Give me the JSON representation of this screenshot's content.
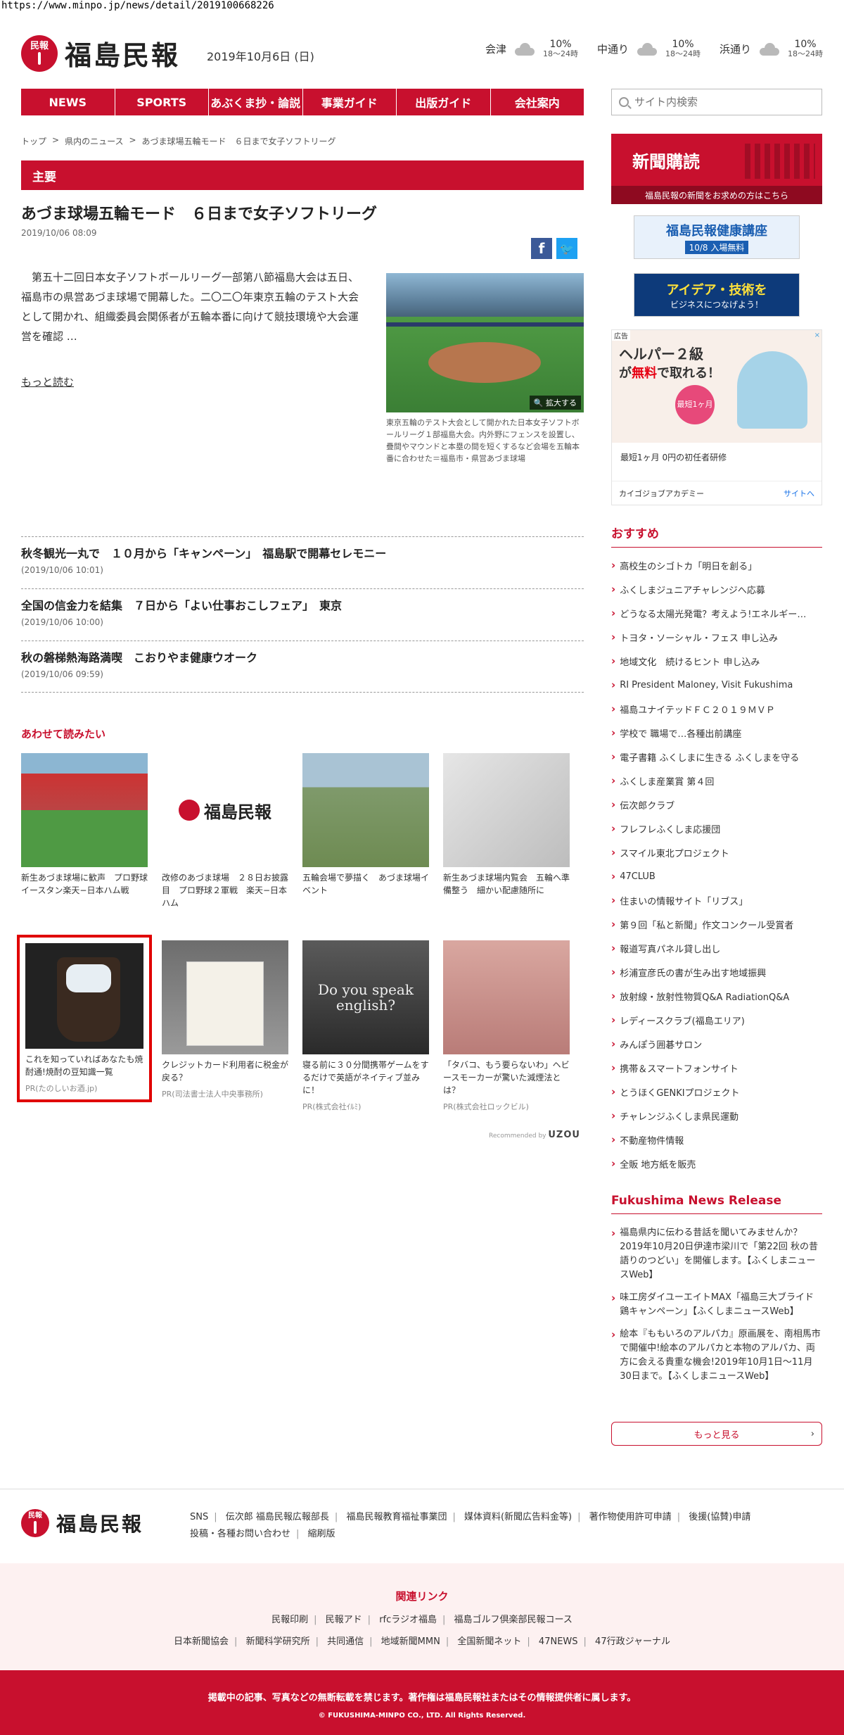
{
  "url": "https://www.minpo.jp/news/detail/2019100668226",
  "header": {
    "logo_mark": "民報",
    "logo_text": "福島民報",
    "date": "2019年10月6日 (日)",
    "weather": [
      {
        "area": "会津",
        "pct": "10%",
        "time": "18〜24時",
        "icon": "cloud-icon"
      },
      {
        "area": "中通り",
        "pct": "10%",
        "time": "18〜24時",
        "icon": "cloud-icon"
      },
      {
        "area": "浜通り",
        "pct": "10%",
        "time": "18〜24時",
        "icon": "cloud-icon"
      }
    ]
  },
  "nav": [
    "NEWS",
    "SPORTS",
    "あぶくま抄・論説",
    "事業ガイド",
    "出版ガイド",
    "会社案内"
  ],
  "search": {
    "placeholder": "サイト内検索"
  },
  "breadcrumb": [
    "トップ",
    ">",
    "県内のニュース",
    ">",
    "あづま球場五輪モード　６日まで女子ソフトリーグ"
  ],
  "article": {
    "section": "主要",
    "title": "あづま球場五輪モード　６日まで女子ソフトリーグ",
    "time": "2019/10/06 08:09",
    "lead": "第五十二回日本女子ソフトボールリーグ一部第八節福島大会は五日、福島市の県営あづま球場で開幕した。二〇二〇年東京五輪のテスト大会として開かれ、組織委員会関係者が五輪本番に向けて競技環境や大会運営を確認 …",
    "more": "もっと読む",
    "zoom": "拡大する",
    "caption": "東京五輪のテスト大会として開かれた日本女子ソフトボールリーグ１部福島大会。内外野にフェンスを設置し、疊間やマウンドと本塁の間を短くするなど会場を五輪本番に合わせた＝福島市・県営あづま球場"
  },
  "news": [
    {
      "title": "秋冬観光一丸で　１０月から「キャンペーン」　福島駅で開幕セレモニー",
      "date": "(2019/10/06 10:01)"
    },
    {
      "title": "全国の信金力を結集　７日から「よい仕事おこしフェア」　東京",
      "date": "(2019/10/06 10:00)"
    },
    {
      "title": "秋の磐梯熱海路満喫　こおりやま健康ウオーク",
      "date": "(2019/10/06 09:59)"
    }
  ],
  "related": {
    "heading": "あわせて読みたい",
    "row1": [
      {
        "title": "新生あづま球場に歓声　プロ野球イースタン楽天−日本ハム戦",
        "pr": ""
      },
      {
        "title": "改修のあづま球場　２８日お披露目　プロ野球２軍戦　楽天−日本ハム",
        "pr": ""
      },
      {
        "title": "五輪会場で夢描く　あづま球場イベント",
        "pr": ""
      },
      {
        "title": "新生あづま球場内覧会　五輪へ準備整う　細かい配慮随所に",
        "pr": ""
      }
    ],
    "row2": [
      {
        "title": "これを知っていればあなたも焼酎通!焼酎の豆知識一覧",
        "pr": "PR(たのしいお酒.jp)"
      },
      {
        "title": "クレジットカード利用者に税金が戻る？",
        "pr": "PR(司法書士法人中央事務所)"
      },
      {
        "title": "寝る前に３０分間携帯ゲームをするだけで英語がネイティブ並みに！",
        "pr": "PR(株式会社ｲﾙﾐ)"
      },
      {
        "title": "「タバコ、もう要らないわ」ヘビースモーカーが驚いた減煙法とは？",
        "pr": "PR(株式会社ロックビル)"
      }
    ],
    "thumb_text": "Do you speak english?",
    "recommended_label": "Recommended by",
    "recommended_brand": "UZOU"
  },
  "sidebar": {
    "subscribe_big": "新聞購読",
    "subscribe_sub": "福島民報の新聞をお求めの方はこちら",
    "banner1_top": "福島民報健康講座",
    "banner1_bot": "10/8 入場無料",
    "banner2_top": "アイデア・技術を",
    "banner2_bot": "ビジネスにつなげよう！",
    "ad": {
      "label": "広告",
      "close": "×",
      "head": "ヘルパー２級",
      "head2_pre": "が",
      "head2_red": "無料",
      "head2_post": "で取れる！",
      "badge": "最短1ヶ月",
      "text": "最短1ヶ月 0円の初任者研修",
      "sponsor": "カイゴジョブアカデミー",
      "site": "サイトへ"
    },
    "osusume_heading": "おすすめ",
    "osusume": [
      "高校生のシゴトカ「明日を創る」",
      "ふくしまジュニアチャレンジへ応募",
      "どうなる太陽光発電？考えよう!エネルギー…",
      "トヨタ・ソーシャル・フェス 申し込み",
      "地域文化　続けるヒント 申し込み",
      "RI President Maloney, Visit Fukushima",
      "福島ユナイテッドＦＣ２０１９ＭＶＰ",
      "学校で 職場で…各種出前講座",
      "電子書籍 ふくしまに生きる ふくしまを守る",
      "ふくしま産業賞 第４回",
      "伝次郎クラブ",
      "フレフレふくしま応援団",
      "スマイル東北プロジェクト",
      "47CLUB",
      "住まいの情報サイト「リブス」",
      "第９回「私と新聞」作文コンクール受賞者",
      "報道写真パネル貸し出し",
      "杉浦宣彦氏の書が生み出す地域振興",
      "放射線・放射性物質Q&A RadiationQ&A",
      "レディースクラブ(福島エリア)",
      "みんぽう囲碁サロン",
      "携帯＆スマートフォンサイト",
      "とうほくGENKIプロジェクト",
      "チャレンジふくしま県民運動",
      "不動産物件情報",
      "全販 地方紙を販売"
    ],
    "release_heading": "Fukushima News Release",
    "release": [
      "福島県内に伝わる昔話を聞いてみませんか？2019年10月20日伊達市梁川で「第22回 秋の昔語りのつどい」を開催します。【ふくしまニュースWeb】",
      "味工房ダイユーエイトMAX「福島三大ブライド鶏キャンペーン」【ふくしまニュースWeb】",
      "絵本『ももいろのアルパカ』原画展を、南相馬市で開催中!絵本のアルパカと本物のアルパカ、両方に会える貴重な機会!2019年10月1日〜11月30日まで。【ふくしまニュースWeb】"
    ],
    "more": "もっと見る"
  },
  "footer": {
    "links": [
      "SNS",
      "伝次郎 福島民報広報部長",
      "福島民報教育福祉事業団",
      "媒体資料(新聞広告料金等)",
      "著作物使用許可申請",
      "後援(協賛)申請",
      "投稿・各種お問い合わせ",
      "縮刷版"
    ],
    "related_heading": "関連リンク",
    "related_row1": [
      "民報印刷",
      "民報アド",
      "rfcラジオ福島",
      "福島ゴルフ倶楽部民報コース"
    ],
    "related_row2": [
      "日本新聞協会",
      "新聞科学研究所",
      "共同通信",
      "地域新聞MMN",
      "全国新聞ネット",
      "47NEWS",
      "47行政ジャーナル"
    ],
    "copy1": "掲載中の記事、写真などの無断転載を禁じます。著作権は福島民報社またはその情報提供者に属します。",
    "copy2": "© FUKUSHIMA-MINPO CO., LTD. All Rights Reserved."
  }
}
